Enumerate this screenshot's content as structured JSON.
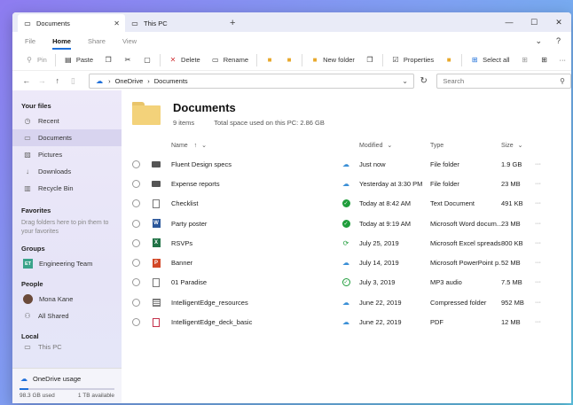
{
  "tabs": [
    {
      "label": "Documents",
      "active": true
    },
    {
      "label": "This PC",
      "active": false
    }
  ],
  "tab_add": "+",
  "window_controls": {
    "minimize": "—",
    "maximize": "☐",
    "close": "✕"
  },
  "ribbon": {
    "tabs": [
      "File",
      "Home",
      "Share",
      "View"
    ],
    "active": "Home",
    "collapse": "⌄",
    "help": "?"
  },
  "toolbar": {
    "pin": "Pin",
    "paste": "Paste",
    "delete": "Delete",
    "rename": "Rename",
    "new_folder": "New folder",
    "properties": "Properties",
    "select_all": "Select all",
    "more": "···"
  },
  "address": {
    "path": [
      "OneDrive",
      "Documents"
    ],
    "separator": "›",
    "search_placeholder": "Search"
  },
  "sidebar": {
    "your_files_label": "Your files",
    "your_files": [
      "Recent",
      "Documents",
      "Pictures",
      "Downloads",
      "Recycle Bin"
    ],
    "active_item": "Documents",
    "favorites_label": "Favorites",
    "favorites_hint": "Drag folders here to pin them to your favorites",
    "groups_label": "Groups",
    "group_badge": "ET",
    "group_name": "Engineering Team",
    "people_label": "People",
    "people": [
      "Mona Kane",
      "All Shared"
    ],
    "local_label": "Local",
    "local_item": "This PC"
  },
  "onedrive": {
    "title": "OneDrive usage",
    "used": "98.3 GB used",
    "available": "1 TB available",
    "used_fraction": 0.098
  },
  "folder": {
    "title": "Documents",
    "items": "9 items",
    "space": "Total space used on this PC: 2.86 GB"
  },
  "columns": {
    "name": "Name",
    "sort_arrow": "↑",
    "chev": "⌄",
    "modified": "Modified",
    "type": "Type",
    "size": "Size"
  },
  "files": [
    {
      "name": "Fluent Design specs",
      "icon": "folder",
      "status": "cloud",
      "modified": "Just now",
      "type": "File folder",
      "size": "1.9 GB"
    },
    {
      "name": "Expense reports",
      "icon": "folder",
      "status": "cloud",
      "modified": "Yesterday at 3:30 PM",
      "type": "File folder",
      "size": "23 MB"
    },
    {
      "name": "Checklist",
      "icon": "doc",
      "status": "ok",
      "modified": "Today at 8:42 AM",
      "type": "Text Document",
      "size": "491 KB"
    },
    {
      "name": "Party poster",
      "icon": "word",
      "status": "ok",
      "modified": "Today at 9:19 AM",
      "type": "Microsoft Word docum...",
      "size": "23 MB"
    },
    {
      "name": "RSVPs",
      "icon": "excel",
      "status": "sync",
      "modified": "July 25, 2019",
      "type": "Microsoft Excel spreads...",
      "size": "800 KB"
    },
    {
      "name": "Banner",
      "icon": "ppt",
      "status": "cloud",
      "modified": "July 14, 2019",
      "type": "Microsoft PowerPoint p...",
      "size": "52 MB"
    },
    {
      "name": "01 Paradise",
      "icon": "audio",
      "status": "check-outline",
      "modified": "July 3, 2019",
      "type": "MP3 audio",
      "size": "7.5 MB"
    },
    {
      "name": "IntelligentEdge_resources",
      "icon": "zip",
      "status": "cloud",
      "modified": "June 22, 2019",
      "type": "Compressed folder",
      "size": "952 MB"
    },
    {
      "name": "IntelligentEdge_deck_basic",
      "icon": "pdf",
      "status": "cloud",
      "modified": "June 22, 2019",
      "type": "PDF",
      "size": "12 MB"
    }
  ],
  "colors": {
    "accent": "#1e6fd9",
    "sync_green": "#1f9d3b",
    "cloud_blue": "#3a8fd6",
    "folder_yellow": "#f3d27a"
  }
}
